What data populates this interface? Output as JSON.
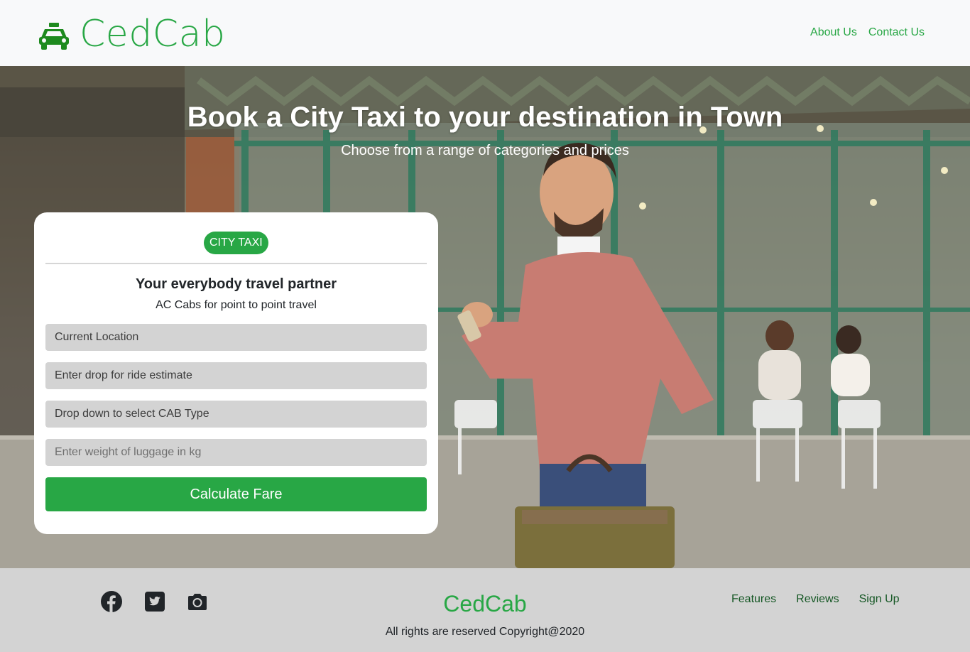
{
  "navbar": {
    "brand": "CedCab",
    "links": [
      "About Us",
      "Contact Us"
    ]
  },
  "hero": {
    "title": "Book a City Taxi to your destination in Town",
    "subtitle": "Choose from a range of categories and prices"
  },
  "card": {
    "badge": "CITY TAXI",
    "title": "Your everybody travel partner",
    "subtitle": "AC Cabs for point to point travel",
    "fields": {
      "pickup": "Current Location",
      "drop": "Enter drop for ride estimate",
      "cab_type": "Drop down to select CAB Type",
      "luggage_placeholder": "Enter weight of luggage in kg"
    },
    "submit": "Calculate Fare"
  },
  "footer": {
    "social_icons": [
      "facebook-icon",
      "twitter-icon",
      "camera-icon"
    ],
    "brand": "CedCab",
    "copyright": "All rights are reserved Copyright@2020",
    "links": [
      "Features",
      "Reviews",
      "Sign Up"
    ]
  },
  "colors": {
    "accent": "#28a745",
    "footer_bg": "#d3d3d3",
    "navbar_bg": "#f8f9fa"
  }
}
